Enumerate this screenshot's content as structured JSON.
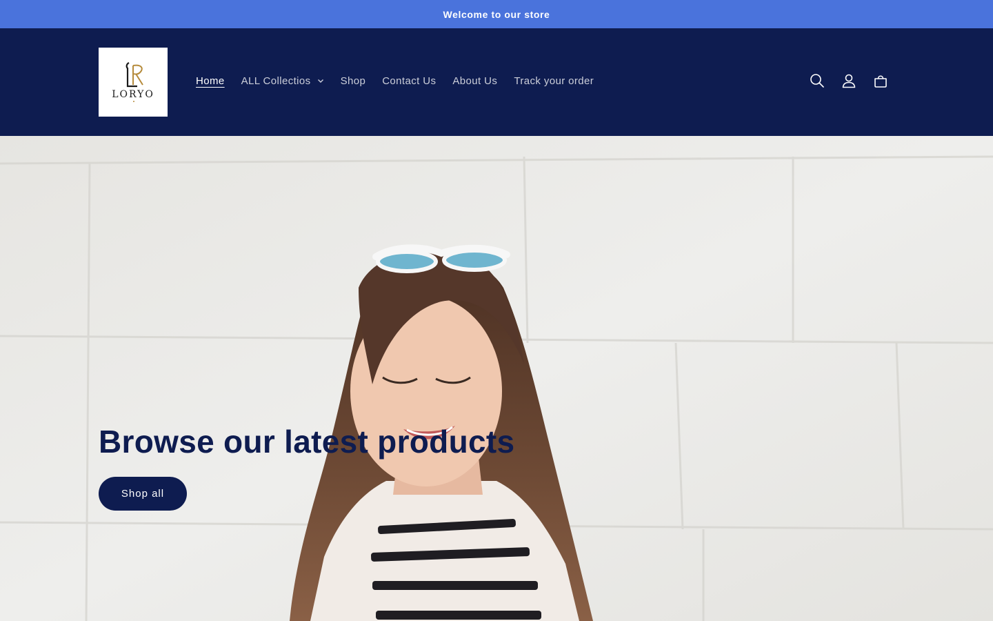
{
  "announcement": {
    "text": "Welcome to our store",
    "background": "#4a73dc"
  },
  "header": {
    "background": "#0e1c50",
    "logo": {
      "brand": "LORYO",
      "monogram": "LR"
    },
    "nav": [
      {
        "label": "Home",
        "active": true
      },
      {
        "label": "ALL Collectios",
        "has_dropdown": true
      },
      {
        "label": "Shop"
      },
      {
        "label": "Contact Us"
      },
      {
        "label": "About Us"
      },
      {
        "label": "Track your order"
      }
    ],
    "icons": [
      "search-icon",
      "account-icon",
      "cart-icon"
    ]
  },
  "hero": {
    "title": "Browse our latest products",
    "button_label": "Shop all",
    "title_color": "#0e1c50",
    "button_color": "#0e1c50",
    "image": "woman with sunglasses on head against white brick wall"
  }
}
